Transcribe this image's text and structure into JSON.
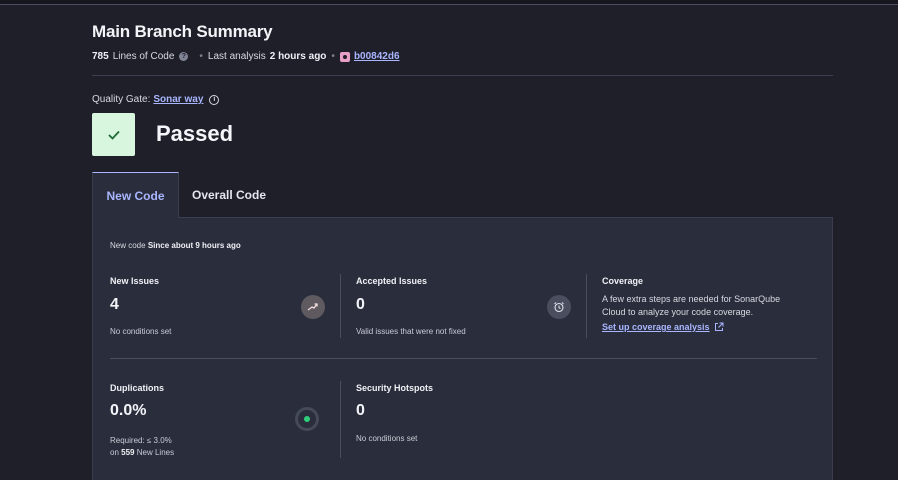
{
  "header": {
    "title": "Main Branch Summary",
    "lines_of_code_value": "785",
    "lines_of_code_label": "Lines of Code",
    "last_analysis_label": "Last analysis",
    "last_analysis_value": "2 hours ago",
    "commit_hash": "b00842d6"
  },
  "quality_gate": {
    "label": "Quality Gate:",
    "gate_name": "Sonar way",
    "status": "Passed"
  },
  "tabs": [
    {
      "label": "New Code",
      "active": true
    },
    {
      "label": "Overall Code",
      "active": false
    }
  ],
  "new_code": {
    "since_prefix": "New code",
    "since_value": "Since about 9 hours ago"
  },
  "cards": {
    "new_issues": {
      "title": "New Issues",
      "value": "4",
      "sub": "No conditions set"
    },
    "accepted_issues": {
      "title": "Accepted Issues",
      "value": "0",
      "sub": "Valid issues that were not fixed"
    },
    "coverage": {
      "title": "Coverage",
      "text": "A few extra steps are needed for SonarQube Cloud to analyze your code coverage.",
      "link": "Set up coverage analysis"
    },
    "duplications": {
      "title": "Duplications",
      "value": "0.0%",
      "required": "Required: ≤ 3.0%",
      "on_prefix": "on",
      "on_lines": "559",
      "on_suffix": "New Lines"
    },
    "security_hotspots": {
      "title": "Security Hotspots",
      "value": "0",
      "sub": "No conditions set"
    }
  },
  "colors": {
    "background": "#1e1f29",
    "panel": "#2a2d3b",
    "accent": "#a9b6ff",
    "passed_bg": "#d8f6dd",
    "passed_check": "#1c6b34",
    "duplication_dot": "#2fcf7a"
  }
}
